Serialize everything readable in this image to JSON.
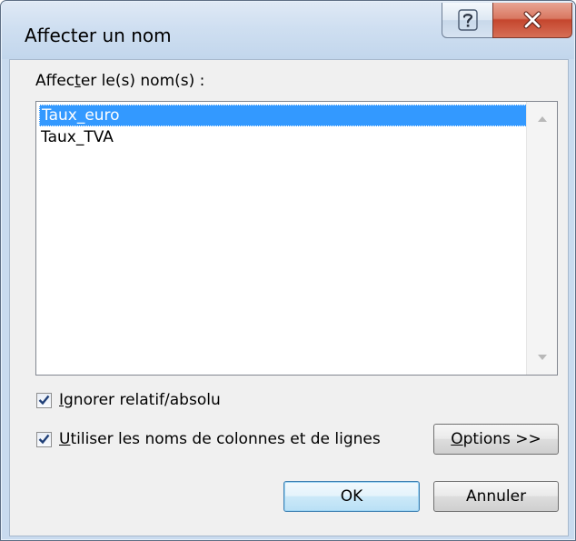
{
  "window": {
    "title": "Affecter un nom"
  },
  "titlebar": {
    "help_icon": "question-mark-icon",
    "close_icon": "close-x-icon"
  },
  "names_section": {
    "label_pre": "Affec",
    "label_accel": "t",
    "label_post": "er le(s) nom(s) :",
    "items": [
      "Taux_euro",
      "Taux_TVA"
    ],
    "selected_index": 0
  },
  "options": {
    "ignore": {
      "accel": "I",
      "rest": "gnorer relatif/absolu",
      "checked": true
    },
    "use_names": {
      "accel": "U",
      "rest": "tiliser les noms de colonnes et de lignes",
      "checked": true
    }
  },
  "buttons": {
    "options_accel": "O",
    "options_rest": "ptions >>",
    "ok": "OK",
    "cancel": "Annuler"
  },
  "colors": {
    "selection": "#3399ff",
    "title_bar": "#cfdff1",
    "close_button": "#c5462e",
    "dialog_bg": "#f0f0f0"
  }
}
